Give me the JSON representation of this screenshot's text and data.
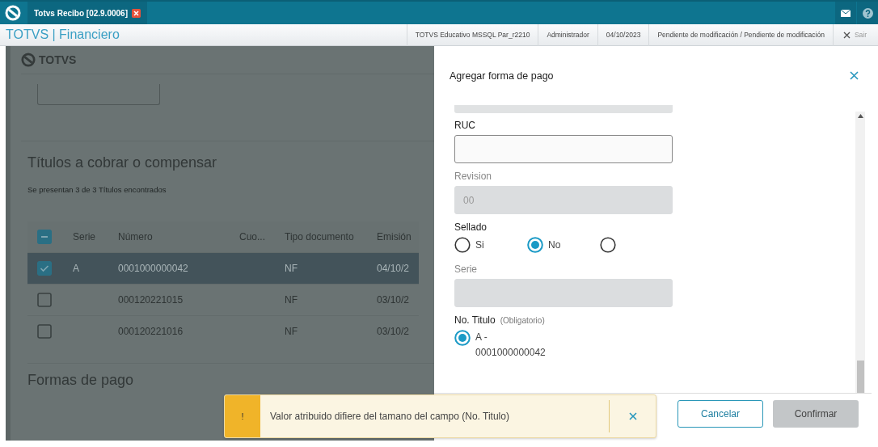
{
  "window": {
    "title": "Totvs Recibo [02.9.0006]"
  },
  "header": {
    "app_title": "TOTVS | Financiero",
    "info": [
      "TOTVS Educativo MSSQL Par_r2210",
      "Administrador",
      "04/10/2023",
      "Pendiente de modificación / Pendiente de modificación"
    ],
    "exit": "Sair"
  },
  "page": {
    "logo": "TOTVS",
    "section_title": "Títulos a cobrar o compensar",
    "summary": "Se presentan 3 de 3 Títulos encontrados",
    "table": {
      "header_indeterminate": true,
      "columns": [
        "Serie",
        "Número",
        "Cuo...",
        "Tipo documento",
        "Emisión"
      ],
      "rows": [
        {
          "selected": true,
          "cells": [
            "A",
            "0001000000042",
            null,
            "NF",
            "04/10/2"
          ]
        },
        {
          "selected": false,
          "cells": [
            null,
            "000120221015",
            null,
            "NF",
            "03/10/2"
          ]
        },
        {
          "selected": false,
          "cells": [
            null,
            "000120221016",
            null,
            "NF",
            "03/10/2"
          ]
        }
      ]
    },
    "payment_title": "Formas de pago"
  },
  "dialog": {
    "title": "Agregar forma de pago",
    "fields": [
      {
        "kind": "text",
        "label": "RUC",
        "disabled": false
      },
      {
        "kind": "text",
        "label": "Revision",
        "value": "00",
        "disabled": true
      },
      {
        "kind": "radio",
        "label": "Sellado",
        "options": [
          {
            "label": "Si",
            "selected": false
          },
          {
            "label": "No",
            "selected": true
          },
          {
            "selected": false
          }
        ]
      },
      {
        "kind": "text",
        "label": "Serie",
        "disabled": true
      },
      {
        "kind": "radio",
        "label": "No. Titulo",
        "hint": "(Obligatorio)",
        "options": [
          {
            "label": "A - 0001000000042",
            "selected": true
          }
        ]
      }
    ],
    "buttons": [
      {
        "label": "Cancelar",
        "kind": "secondary",
        "disabled": false
      },
      {
        "label": "Confirmar",
        "kind": "primary",
        "disabled": true
      }
    ]
  },
  "toast": {
    "icon": "!",
    "message": "Valor atribuido difiere del tamano del campo (No. Titulo)"
  }
}
